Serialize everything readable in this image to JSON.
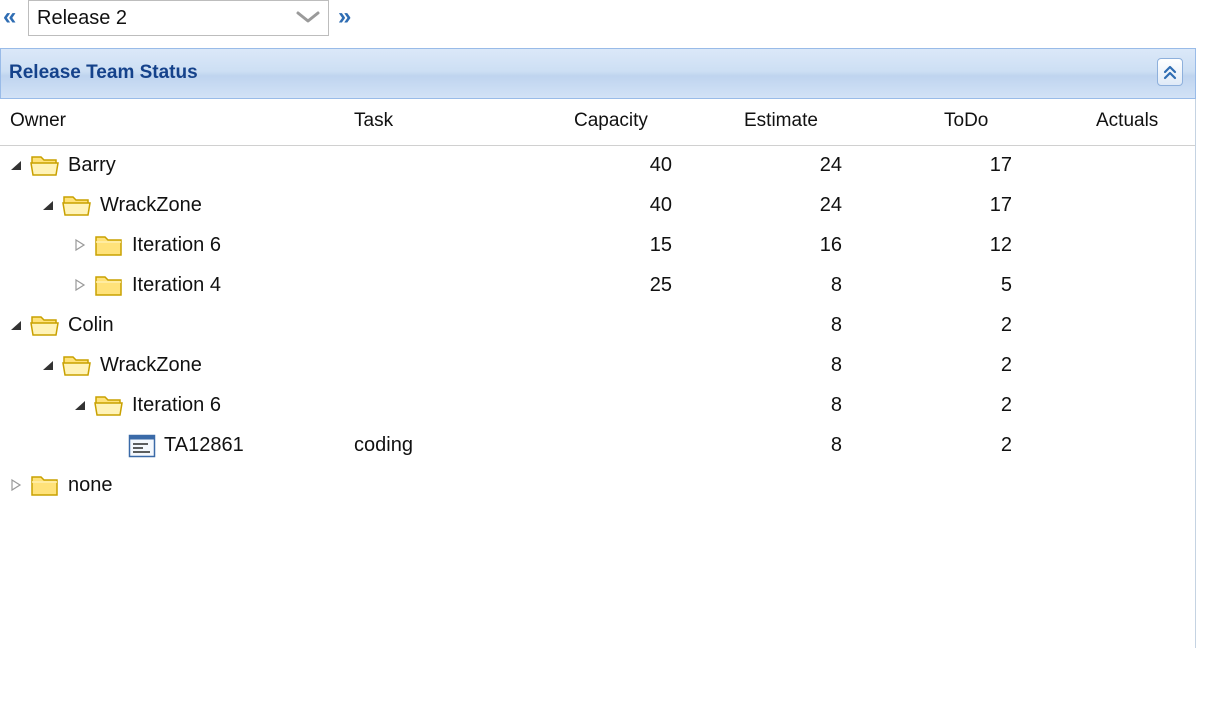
{
  "release_picker": {
    "prev_label": "«",
    "next_label": "»",
    "selected": "Release 2"
  },
  "panel": {
    "title": "Release Team Status"
  },
  "columns": {
    "owner": "Owner",
    "task": "Task",
    "capacity": "Capacity",
    "estimate": "Estimate",
    "todo": "ToDo",
    "actuals": "Actuals"
  },
  "rows": [
    {
      "label": "Barry",
      "task": "",
      "capacity": "40",
      "estimate": "24",
      "todo": "17",
      "actuals": "",
      "level": 0,
      "state": "expanded",
      "icon": "folder-open-icon"
    },
    {
      "label": "WrackZone",
      "task": "",
      "capacity": "40",
      "estimate": "24",
      "todo": "17",
      "actuals": "",
      "level": 1,
      "state": "expanded",
      "icon": "folder-open-icon"
    },
    {
      "label": "Iteration 6",
      "task": "",
      "capacity": "15",
      "estimate": "16",
      "todo": "12",
      "actuals": "",
      "level": 2,
      "state": "collapsed",
      "icon": "folder-closed-icon"
    },
    {
      "label": "Iteration 4",
      "task": "",
      "capacity": "25",
      "estimate": "8",
      "todo": "5",
      "actuals": "",
      "level": 2,
      "state": "collapsed",
      "icon": "folder-closed-icon"
    },
    {
      "label": "Colin",
      "task": "",
      "capacity": "",
      "estimate": "8",
      "todo": "2",
      "actuals": "",
      "level": 0,
      "state": "expanded",
      "icon": "folder-open-icon"
    },
    {
      "label": "WrackZone",
      "task": "",
      "capacity": "",
      "estimate": "8",
      "todo": "2",
      "actuals": "",
      "level": 1,
      "state": "expanded",
      "icon": "folder-open-icon"
    },
    {
      "label": "Iteration 6",
      "task": "",
      "capacity": "",
      "estimate": "8",
      "todo": "2",
      "actuals": "",
      "level": 2,
      "state": "expanded",
      "icon": "folder-open-icon"
    },
    {
      "label": "TA12861",
      "task": "coding",
      "capacity": "",
      "estimate": "8",
      "todo": "2",
      "actuals": "",
      "level": 3,
      "state": "leaf",
      "icon": "task-card-icon"
    },
    {
      "label": "none",
      "task": "",
      "capacity": "",
      "estimate": "",
      "todo": "",
      "actuals": "",
      "level": 0,
      "state": "collapsed",
      "icon": "folder-closed-icon"
    }
  ],
  "colors": {
    "accent": "#2f6db3",
    "header_title": "#15428b",
    "header_border": "#99bbe8",
    "folder_fill": "#ffe27a",
    "folder_stroke": "#c9a100"
  }
}
